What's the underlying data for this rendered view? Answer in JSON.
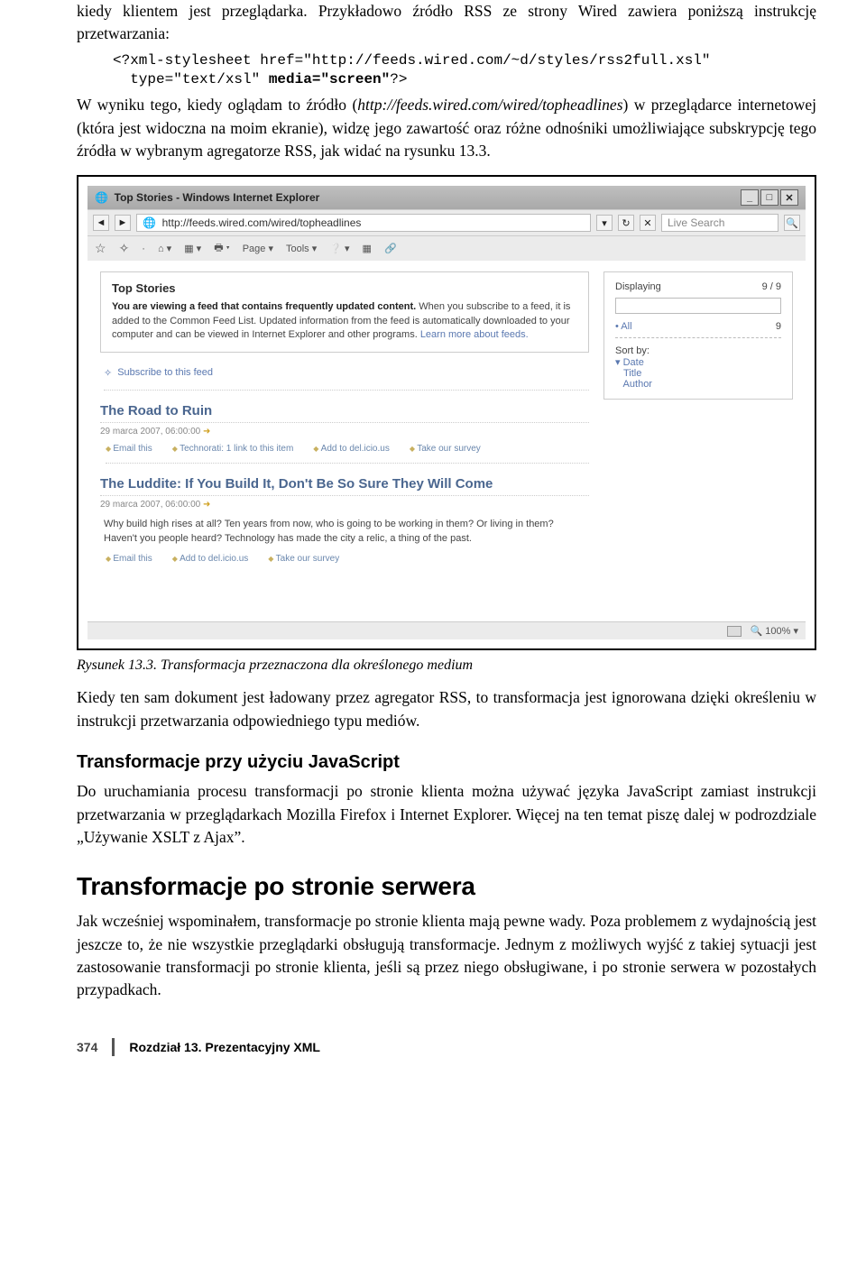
{
  "intro1": "kiedy klientem jest przeglądarka. Przykładowo źródło RSS ze strony Wired zawiera poniższą instrukcję przetwarzania:",
  "code_line1": "<?xml-stylesheet href=\"http://feeds.wired.com/~d/styles/rss2full.xsl\"",
  "code_line2a": "  type=\"text/xsl\" ",
  "code_line2b": "media=\"screen\"",
  "code_line2c": "?>",
  "intro2a": "W wyniku tego, kiedy oglądam to źródło (",
  "intro2b": "http://feeds.wired.com/wired/topheadlines",
  "intro2c": ") w przeglądarce internetowej (która jest widoczna na moim ekranie), widzę jego zawartość oraz różne odnośniki umożliwiające subskrypcję tego źródła w wybranym agregatorze RSS, jak widać na rysunku 13.3.",
  "ie": {
    "title_prefix": "Top Stories - Windows Internet Explorer",
    "url_prefix": "http://feeds.wired.com/wired/topheadlines",
    "search_placeholder": "Live Search",
    "toolbar_page": "Page ▾",
    "toolbar_tools": "Tools ▾",
    "ts_title": "Top Stories",
    "ts_bold": "You are viewing a feed that contains frequently updated content.",
    "ts_text": " When you subscribe to a feed, it is added to the Common Feed List. Updated information from the feed is automatically downloaded to your computer and can be viewed in Internet Explorer and other programs. ",
    "ts_learn": "Learn more about feeds.",
    "subscribe": "Subscribe to this feed",
    "disp_label": "Displaying",
    "disp_val": "9 / 9",
    "all_label": "• All",
    "all_val": "9",
    "sort_label": "Sort by:",
    "sort_date": "▾ Date",
    "sort_title": "   Title",
    "sort_author": "   Author",
    "entry1_title": "The Road to Ruin",
    "entry1_date": "29 marca 2007, 06:00:00",
    "a_email": "Email this",
    "a_tech": "Technorati: 1 link to this item",
    "a_del": "Add to del.icio.us",
    "a_survey": "Take our survey",
    "entry2_title": "The Luddite: If You Build It, Don't Be So Sure They Will Come",
    "entry2_date": "29 marca 2007, 06:00:00",
    "entry2_snip": "Why build high rises at all? Ten years from now, who is going to be working in them? Or living in them? Haven't you people heard? Technology has made the city a relic, a thing of the past.",
    "zoom": "100%"
  },
  "caption": "Rysunek 13.3. Transformacja przeznaczona dla określonego medium",
  "para_after_fig": "Kiedy ten sam dokument jest ładowany przez agregator RSS, to transformacja jest ignorowana dzięki określeniu w instrukcji przetwarzania odpowiedniego typu mediów.",
  "h_js": "Transformacje przy użyciu JavaScript",
  "para_js": "Do uruchamiania procesu transformacji po stronie klienta można używać języka JavaScript zamiast instrukcji przetwarzania w przeglądarkach Mozilla Firefox i Internet Explorer. Więcej na ten temat piszę dalej w podrozdziale „Używanie XSLT z Ajax”.",
  "h_server": "Transformacje po stronie serwera",
  "para_server": "Jak wcześniej wspominałem, transformacje po stronie klienta mają pewne wady. Poza problemem z wydajnością jest jeszcze to, że nie wszystkie przeglądarki obsługują transformacje. Jednym z możliwych wyjść z takiej sytuacji jest zastosowanie transformacji po stronie klienta, jeśli są przez niego obsługiwane, i po stronie serwera w pozostałych przypadkach.",
  "footer_page": "374",
  "footer_chapter": "Rozdział 13. Prezentacyjny XML"
}
